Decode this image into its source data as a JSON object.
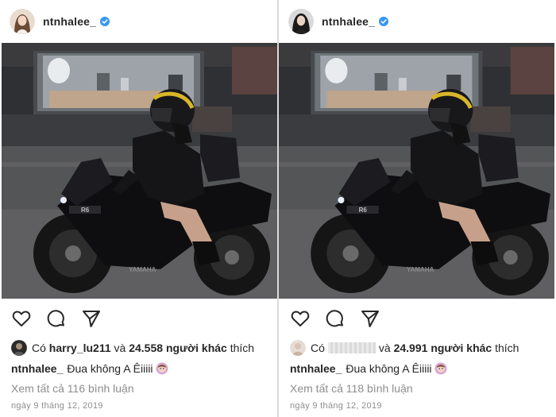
{
  "posts": [
    {
      "username": "ntnhalee_",
      "likes": {
        "prefix": "Có",
        "liker": "harry_lu211",
        "connector": "và",
        "count": "24.558",
        "others": "người khác",
        "suffix": "thích"
      },
      "caption": {
        "user": "ntnhalee_",
        "text": "Đua không A Êiiiii"
      },
      "comments_link": "Xem tất cả 116 bình luận",
      "date": "ngày 9 tháng 12, 2019"
    },
    {
      "username": "ntnhalee_",
      "likes": {
        "prefix": "Có",
        "liker": "",
        "connector": "và",
        "count": "24.991",
        "others": "người khác",
        "suffix": "thích"
      },
      "caption": {
        "user": "ntnhalee_",
        "text": "Đua không A Êiiiii"
      },
      "comments_link": "Xem tất cả 118 bình luận",
      "date": "ngày 9 tháng 12, 2019"
    }
  ],
  "icons": {
    "verified": "verified-badge-icon",
    "like": "heart-icon",
    "comment": "comment-bubble-icon",
    "share": "paper-plane-icon",
    "emoji": "woman-emoji-icon"
  },
  "colors": {
    "verified": "#3897f0",
    "text": "#262626",
    "muted": "#8e8e8e"
  }
}
